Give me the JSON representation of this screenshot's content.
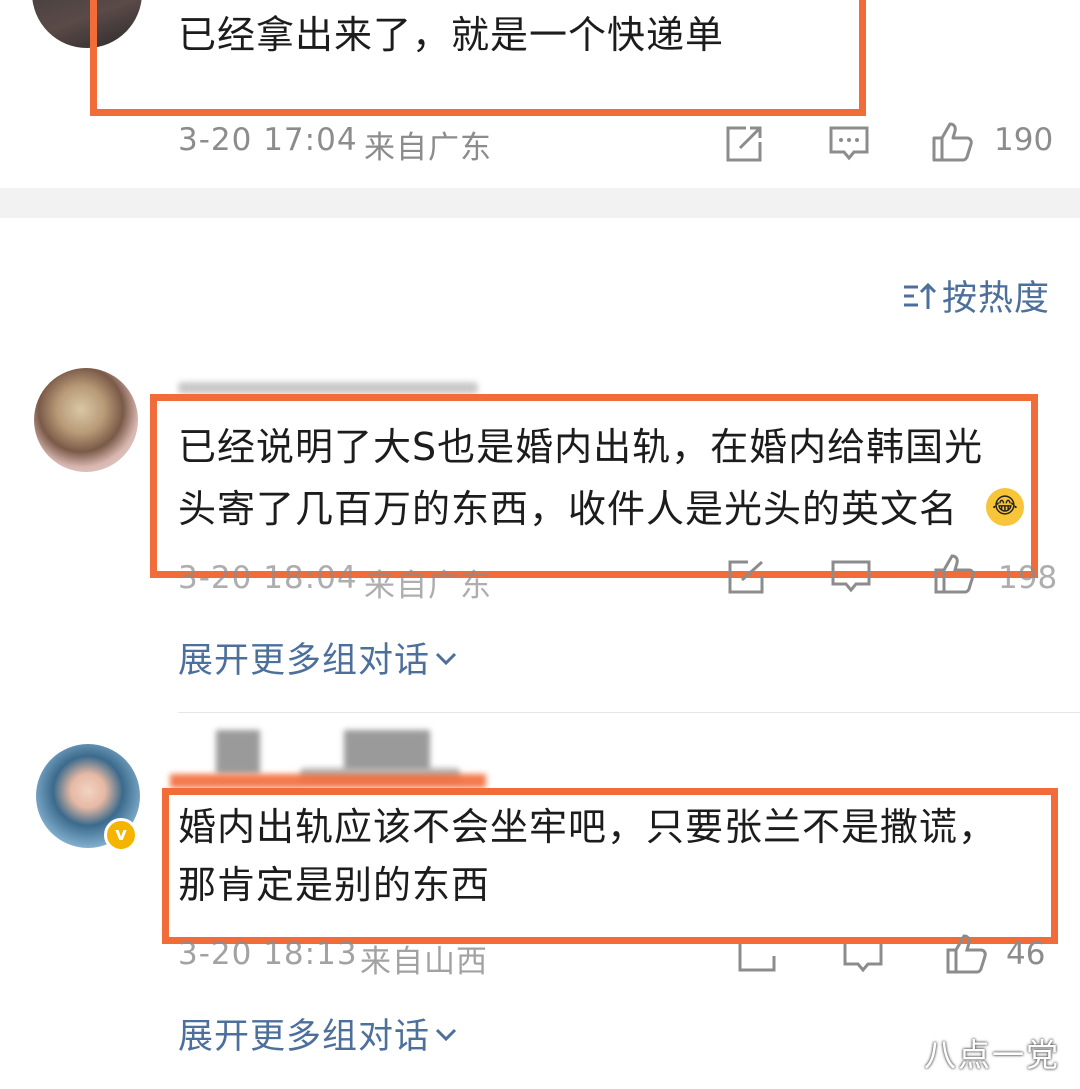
{
  "comment_top": {
    "text": "已经拿出来了，就是一个快递单",
    "time": "3-20 17:04",
    "location": "来自广东",
    "likes": "190"
  },
  "sort": {
    "label": "按热度"
  },
  "comment_1": {
    "line1": "已经说明了大S也是婚内出轨，在婚内给韩国光",
    "line2": "头寄了几百万的东西，收件人是光头的英文名",
    "time": "3-20 18:04",
    "location": "来自广东",
    "likes": "198"
  },
  "expand_1": {
    "label": "展开更多组对话"
  },
  "comment_2": {
    "line1": "婚内出轨应该不会坐牢吧，只要张兰不是撒谎，",
    "line2": "那肯定是别的东西",
    "time": "3-20 18:13",
    "location": "来自山西",
    "likes": "46"
  },
  "expand_2": {
    "label": "展开更多组对话"
  },
  "watermark": {
    "text": "八点一党"
  },
  "colors": {
    "highlight": "#f26c3a",
    "link": "#4d6f9c",
    "meta": "#8c8c8c"
  }
}
